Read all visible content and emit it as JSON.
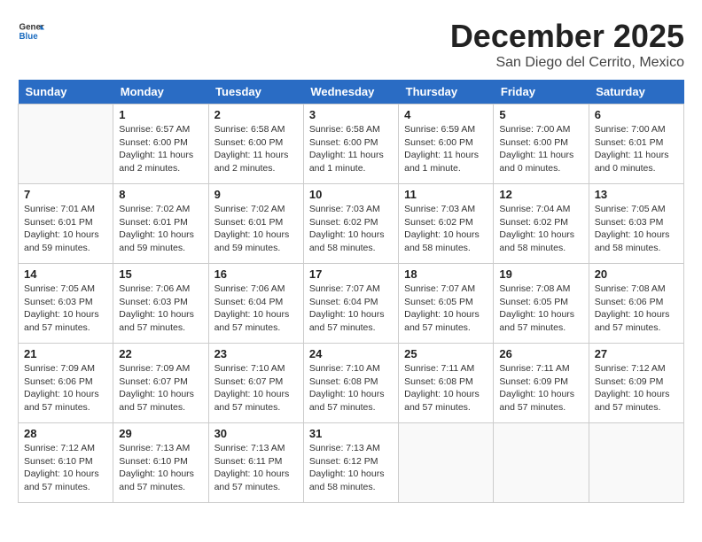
{
  "header": {
    "logo_general": "General",
    "logo_blue": "Blue",
    "month_title": "December 2025",
    "location": "San Diego del Cerrito, Mexico"
  },
  "days_of_week": [
    "Sunday",
    "Monday",
    "Tuesday",
    "Wednesday",
    "Thursday",
    "Friday",
    "Saturday"
  ],
  "weeks": [
    [
      {
        "day": "",
        "info": ""
      },
      {
        "day": "1",
        "info": "Sunrise: 6:57 AM\nSunset: 6:00 PM\nDaylight: 11 hours\nand 2 minutes."
      },
      {
        "day": "2",
        "info": "Sunrise: 6:58 AM\nSunset: 6:00 PM\nDaylight: 11 hours\nand 2 minutes."
      },
      {
        "day": "3",
        "info": "Sunrise: 6:58 AM\nSunset: 6:00 PM\nDaylight: 11 hours\nand 1 minute."
      },
      {
        "day": "4",
        "info": "Sunrise: 6:59 AM\nSunset: 6:00 PM\nDaylight: 11 hours\nand 1 minute."
      },
      {
        "day": "5",
        "info": "Sunrise: 7:00 AM\nSunset: 6:00 PM\nDaylight: 11 hours\nand 0 minutes."
      },
      {
        "day": "6",
        "info": "Sunrise: 7:00 AM\nSunset: 6:01 PM\nDaylight: 11 hours\nand 0 minutes."
      }
    ],
    [
      {
        "day": "7",
        "info": "Sunrise: 7:01 AM\nSunset: 6:01 PM\nDaylight: 10 hours\nand 59 minutes."
      },
      {
        "day": "8",
        "info": "Sunrise: 7:02 AM\nSunset: 6:01 PM\nDaylight: 10 hours\nand 59 minutes."
      },
      {
        "day": "9",
        "info": "Sunrise: 7:02 AM\nSunset: 6:01 PM\nDaylight: 10 hours\nand 59 minutes."
      },
      {
        "day": "10",
        "info": "Sunrise: 7:03 AM\nSunset: 6:02 PM\nDaylight: 10 hours\nand 58 minutes."
      },
      {
        "day": "11",
        "info": "Sunrise: 7:03 AM\nSunset: 6:02 PM\nDaylight: 10 hours\nand 58 minutes."
      },
      {
        "day": "12",
        "info": "Sunrise: 7:04 AM\nSunset: 6:02 PM\nDaylight: 10 hours\nand 58 minutes."
      },
      {
        "day": "13",
        "info": "Sunrise: 7:05 AM\nSunset: 6:03 PM\nDaylight: 10 hours\nand 58 minutes."
      }
    ],
    [
      {
        "day": "14",
        "info": "Sunrise: 7:05 AM\nSunset: 6:03 PM\nDaylight: 10 hours\nand 57 minutes."
      },
      {
        "day": "15",
        "info": "Sunrise: 7:06 AM\nSunset: 6:03 PM\nDaylight: 10 hours\nand 57 minutes."
      },
      {
        "day": "16",
        "info": "Sunrise: 7:06 AM\nSunset: 6:04 PM\nDaylight: 10 hours\nand 57 minutes."
      },
      {
        "day": "17",
        "info": "Sunrise: 7:07 AM\nSunset: 6:04 PM\nDaylight: 10 hours\nand 57 minutes."
      },
      {
        "day": "18",
        "info": "Sunrise: 7:07 AM\nSunset: 6:05 PM\nDaylight: 10 hours\nand 57 minutes."
      },
      {
        "day": "19",
        "info": "Sunrise: 7:08 AM\nSunset: 6:05 PM\nDaylight: 10 hours\nand 57 minutes."
      },
      {
        "day": "20",
        "info": "Sunrise: 7:08 AM\nSunset: 6:06 PM\nDaylight: 10 hours\nand 57 minutes."
      }
    ],
    [
      {
        "day": "21",
        "info": "Sunrise: 7:09 AM\nSunset: 6:06 PM\nDaylight: 10 hours\nand 57 minutes."
      },
      {
        "day": "22",
        "info": "Sunrise: 7:09 AM\nSunset: 6:07 PM\nDaylight: 10 hours\nand 57 minutes."
      },
      {
        "day": "23",
        "info": "Sunrise: 7:10 AM\nSunset: 6:07 PM\nDaylight: 10 hours\nand 57 minutes."
      },
      {
        "day": "24",
        "info": "Sunrise: 7:10 AM\nSunset: 6:08 PM\nDaylight: 10 hours\nand 57 minutes."
      },
      {
        "day": "25",
        "info": "Sunrise: 7:11 AM\nSunset: 6:08 PM\nDaylight: 10 hours\nand 57 minutes."
      },
      {
        "day": "26",
        "info": "Sunrise: 7:11 AM\nSunset: 6:09 PM\nDaylight: 10 hours\nand 57 minutes."
      },
      {
        "day": "27",
        "info": "Sunrise: 7:12 AM\nSunset: 6:09 PM\nDaylight: 10 hours\nand 57 minutes."
      }
    ],
    [
      {
        "day": "28",
        "info": "Sunrise: 7:12 AM\nSunset: 6:10 PM\nDaylight: 10 hours\nand 57 minutes."
      },
      {
        "day": "29",
        "info": "Sunrise: 7:13 AM\nSunset: 6:10 PM\nDaylight: 10 hours\nand 57 minutes."
      },
      {
        "day": "30",
        "info": "Sunrise: 7:13 AM\nSunset: 6:11 PM\nDaylight: 10 hours\nand 57 minutes."
      },
      {
        "day": "31",
        "info": "Sunrise: 7:13 AM\nSunset: 6:12 PM\nDaylight: 10 hours\nand 58 minutes."
      },
      {
        "day": "",
        "info": ""
      },
      {
        "day": "",
        "info": ""
      },
      {
        "day": "",
        "info": ""
      }
    ]
  ]
}
